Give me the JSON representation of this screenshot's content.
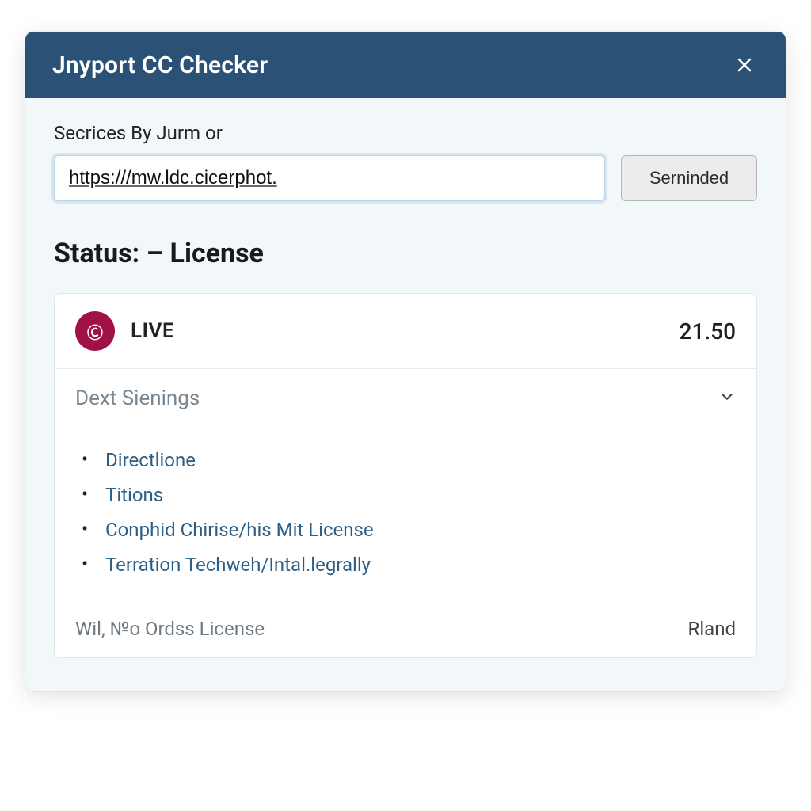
{
  "modal": {
    "title": "Jnyport CC Checker"
  },
  "form": {
    "label": "Secrices By Jurm or",
    "url_value": "https:///mw.ldc.cicerphot.",
    "submit_label": "Serninded"
  },
  "status": {
    "heading": "Status: – License"
  },
  "result": {
    "badge_glyph": "Ⓒ",
    "live_label": "LIVE",
    "live_value": "21.50",
    "section_title": "Dext Sienings",
    "links": [
      "Directlione",
      "Titions",
      "Conphid Chirise/his Mit License",
      "Terration Techweh/Intal.legrally"
    ],
    "footer_left": "Wil, №o Ordss License",
    "footer_right": "Rland"
  }
}
